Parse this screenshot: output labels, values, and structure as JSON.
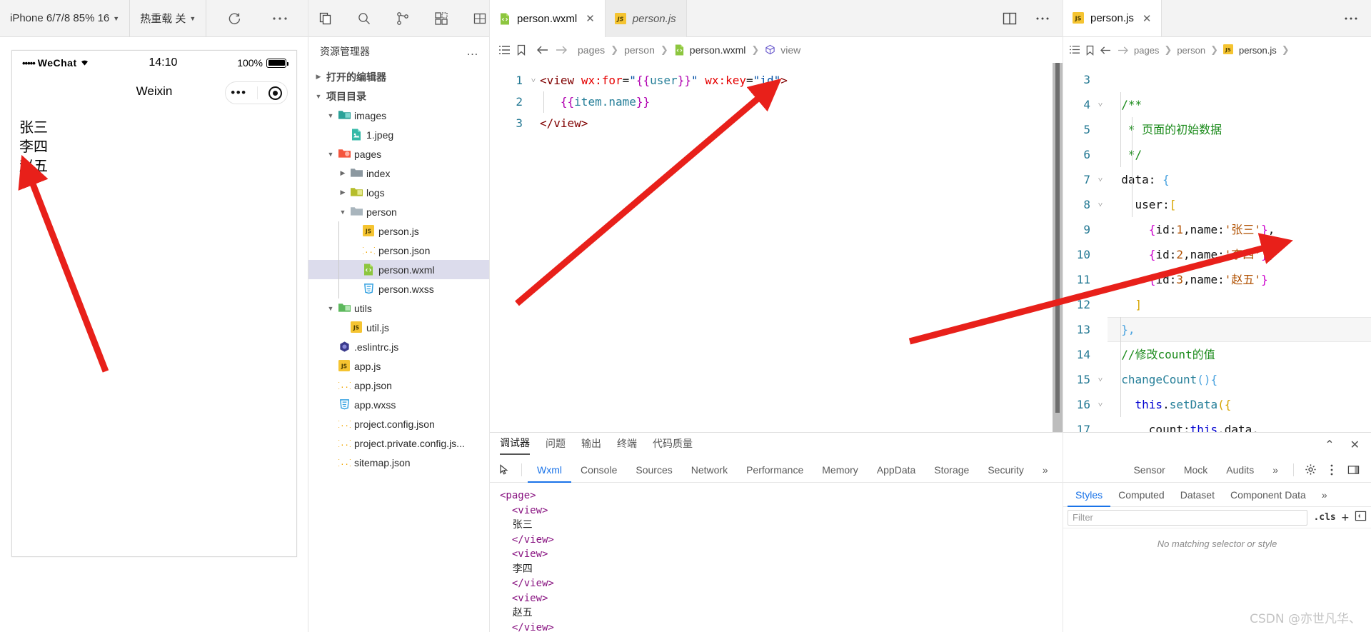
{
  "simulator": {
    "device_label": "iPhone 6/7/8 85% 16",
    "hot_reload_label": "热重载 关",
    "refresh_icon": "refresh-icon",
    "more_icon": "more-icon",
    "status_bar": {
      "carrier": "WeChat",
      "dots": "•••••",
      "time": "14:10",
      "battery_pct": "100%"
    },
    "nav_title": "Weixin",
    "capsule_dots": "•••",
    "preview_items": [
      "张三",
      "李四",
      "赵五"
    ]
  },
  "activity_bar": {
    "icons": [
      "copy-files-icon",
      "search-icon",
      "source-control-icon",
      "extensions-icon",
      "layout-icon",
      "docker-icon"
    ]
  },
  "explorer": {
    "title": "资源管理器",
    "more_label": "…",
    "sections": [
      {
        "label": "打开的编辑器",
        "expanded": false
      },
      {
        "label": "项目目录",
        "expanded": true
      }
    ],
    "tree": [
      {
        "label": "images",
        "kind": "folder-images",
        "depth": 1,
        "expanded": true,
        "selected": false
      },
      {
        "label": "1.jpeg",
        "kind": "image",
        "depth": 2,
        "expanded": null,
        "selected": false
      },
      {
        "label": "pages",
        "kind": "folder-pages",
        "depth": 1,
        "expanded": true,
        "selected": false
      },
      {
        "label": "index",
        "kind": "folder",
        "depth": 2,
        "expanded": false,
        "selected": false
      },
      {
        "label": "logs",
        "kind": "folder-logs",
        "depth": 2,
        "expanded": false,
        "selected": false
      },
      {
        "label": "person",
        "kind": "folder-open",
        "depth": 2,
        "expanded": true,
        "selected": false
      },
      {
        "label": "person.js",
        "kind": "js",
        "depth": 3,
        "expanded": null,
        "selected": false
      },
      {
        "label": "person.json",
        "kind": "json",
        "depth": 3,
        "expanded": null,
        "selected": false
      },
      {
        "label": "person.wxml",
        "kind": "wxml",
        "depth": 3,
        "expanded": null,
        "selected": true
      },
      {
        "label": "person.wxss",
        "kind": "wxss",
        "depth": 3,
        "expanded": null,
        "selected": false
      },
      {
        "label": "utils",
        "kind": "folder-utils",
        "depth": 1,
        "expanded": true,
        "selected": false
      },
      {
        "label": "util.js",
        "kind": "js",
        "depth": 2,
        "expanded": null,
        "selected": false
      },
      {
        "label": ".eslintrc.js",
        "kind": "eslint",
        "depth": 1,
        "expanded": null,
        "selected": false
      },
      {
        "label": "app.js",
        "kind": "js",
        "depth": 1,
        "expanded": null,
        "selected": false
      },
      {
        "label": "app.json",
        "kind": "json",
        "depth": 1,
        "expanded": null,
        "selected": false
      },
      {
        "label": "app.wxss",
        "kind": "wxss",
        "depth": 1,
        "expanded": null,
        "selected": false
      },
      {
        "label": "project.config.json",
        "kind": "json",
        "depth": 1,
        "expanded": null,
        "selected": false
      },
      {
        "label": "project.private.config.js...",
        "kind": "json",
        "depth": 1,
        "expanded": null,
        "selected": false
      },
      {
        "label": "sitemap.json",
        "kind": "json",
        "depth": 1,
        "expanded": null,
        "selected": false
      }
    ]
  },
  "center_editor": {
    "tabs": [
      {
        "label": "person.wxml",
        "kind": "wxml",
        "active": true,
        "closable": true
      },
      {
        "label": "person.js",
        "kind": "js",
        "active": false,
        "closable": false
      }
    ],
    "actions": [
      "split-editor-icon",
      "more-actions-icon"
    ],
    "breadcrumb": [
      "pages",
      "person",
      "person.wxml",
      "view"
    ],
    "toolbar_icons": [
      "outline-icon",
      "bookmark-icon",
      "back-icon",
      "forward-icon"
    ],
    "lines": [
      {
        "n": 1,
        "fold": "˅",
        "tokens": [
          {
            "t": "<",
            "c": "t-brk"
          },
          {
            "t": "view",
            "c": "t-tag"
          },
          {
            "t": " ",
            "c": "t-plain"
          },
          {
            "t": "wx:for",
            "c": "t-attr"
          },
          {
            "t": "=",
            "c": "t-eq"
          },
          {
            "t": "\"",
            "c": "t-str"
          },
          {
            "t": "{{",
            "c": "t-brace"
          },
          {
            "t": "user",
            "c": "t-ident"
          },
          {
            "t": "}}",
            "c": "t-brace"
          },
          {
            "t": "\"",
            "c": "t-str"
          },
          {
            "t": " ",
            "c": "t-plain"
          },
          {
            "t": "wx:key",
            "c": "t-attr"
          },
          {
            "t": "=",
            "c": "t-eq"
          },
          {
            "t": "\"id\"",
            "c": "t-str"
          },
          {
            "t": ">",
            "c": "t-brk"
          }
        ]
      },
      {
        "n": 2,
        "fold": "",
        "tokens": [
          {
            "t": "   ",
            "c": "t-plain"
          },
          {
            "t": "{{",
            "c": "t-brace"
          },
          {
            "t": "item.name",
            "c": "t-ident"
          },
          {
            "t": "}}",
            "c": "t-brace"
          }
        ]
      },
      {
        "n": 3,
        "fold": "",
        "tokens": [
          {
            "t": "</",
            "c": "t-brk"
          },
          {
            "t": "view",
            "c": "t-tag"
          },
          {
            "t": ">",
            "c": "t-brk"
          }
        ]
      }
    ]
  },
  "right_editor": {
    "tabs": [
      {
        "label": "person.js",
        "kind": "js",
        "active": true,
        "closable": true
      }
    ],
    "actions": [
      "more-actions-icon"
    ],
    "breadcrumb": [
      "pages",
      "person",
      "person.js"
    ],
    "toolbar_icons": [
      "outline-icon",
      "bookmark-icon",
      "back-icon",
      "forward-icon"
    ],
    "lines": [
      {
        "n": 3,
        "fold": "",
        "tokens": []
      },
      {
        "n": 4,
        "fold": "˅",
        "tokens": [
          {
            "t": "  ",
            "c": "t-plain"
          },
          {
            "t": "/**",
            "c": "t-cmt"
          }
        ]
      },
      {
        "n": 5,
        "fold": "",
        "tokens": [
          {
            "t": "   ",
            "c": "t-plain"
          },
          {
            "t": "* 页面的初始数据",
            "c": "t-cmt"
          }
        ]
      },
      {
        "n": 6,
        "fold": "",
        "tokens": [
          {
            "t": "   ",
            "c": "t-plain"
          },
          {
            "t": "*/",
            "c": "t-cmt"
          }
        ]
      },
      {
        "n": 7,
        "fold": "˅",
        "tokens": [
          {
            "t": "  ",
            "c": "t-plain"
          },
          {
            "t": "data",
            "c": "t-plain"
          },
          {
            "t": ": ",
            "c": "t-plain"
          },
          {
            "t": "{",
            "c": "t-brk-b"
          }
        ]
      },
      {
        "n": 8,
        "fold": "˅",
        "tokens": [
          {
            "t": "    ",
            "c": "t-plain"
          },
          {
            "t": "user",
            "c": "t-plain"
          },
          {
            "t": ":",
            "c": "t-plain"
          },
          {
            "t": "[",
            "c": "t-brk-y"
          }
        ]
      },
      {
        "n": 9,
        "fold": "",
        "tokens": [
          {
            "t": "      ",
            "c": "t-plain"
          },
          {
            "t": "{",
            "c": "t-brk-p"
          },
          {
            "t": "id",
            "c": "t-plain"
          },
          {
            "t": ":",
            "c": "t-plain"
          },
          {
            "t": "1",
            "c": "t-num"
          },
          {
            "t": ",",
            "c": "t-plain"
          },
          {
            "t": "name",
            "c": "t-plain"
          },
          {
            "t": ":",
            "c": "t-plain"
          },
          {
            "t": "'张三'",
            "c": "t-num"
          },
          {
            "t": "}",
            "c": "t-brk-p"
          },
          {
            "t": ",",
            "c": "t-plain"
          }
        ]
      },
      {
        "n": 10,
        "fold": "",
        "tokens": [
          {
            "t": "      ",
            "c": "t-plain"
          },
          {
            "t": "{",
            "c": "t-brk-p"
          },
          {
            "t": "id",
            "c": "t-plain"
          },
          {
            "t": ":",
            "c": "t-plain"
          },
          {
            "t": "2",
            "c": "t-num"
          },
          {
            "t": ",",
            "c": "t-plain"
          },
          {
            "t": "name",
            "c": "t-plain"
          },
          {
            "t": ":",
            "c": "t-plain"
          },
          {
            "t": "'李四'",
            "c": "t-num"
          },
          {
            "t": "}",
            "c": "t-brk-p"
          },
          {
            "t": ",",
            "c": "t-plain"
          }
        ]
      },
      {
        "n": 11,
        "fold": "",
        "tokens": [
          {
            "t": "      ",
            "c": "t-plain"
          },
          {
            "t": "{",
            "c": "t-brk-p"
          },
          {
            "t": "id",
            "c": "t-plain"
          },
          {
            "t": ":",
            "c": "t-plain"
          },
          {
            "t": "3",
            "c": "t-num"
          },
          {
            "t": ",",
            "c": "t-plain"
          },
          {
            "t": "name",
            "c": "t-plain"
          },
          {
            "t": ":",
            "c": "t-plain"
          },
          {
            "t": "'赵五'",
            "c": "t-num"
          },
          {
            "t": "}",
            "c": "t-brk-p"
          }
        ]
      },
      {
        "n": 12,
        "fold": "",
        "tokens": [
          {
            "t": "    ",
            "c": "t-plain"
          },
          {
            "t": "]",
            "c": "t-brk-y"
          }
        ]
      },
      {
        "n": 13,
        "fold": "",
        "tokens": [
          {
            "t": "  ",
            "c": "t-plain"
          },
          {
            "t": "}",
            "c": "t-brk-b"
          },
          {
            "t": ",",
            "c": "t-brk-b"
          }
        ]
      },
      {
        "n": 14,
        "fold": "",
        "tokens": [
          {
            "t": "  ",
            "c": "t-plain"
          },
          {
            "t": "//修改count的值",
            "c": "t-cmt"
          }
        ]
      },
      {
        "n": 15,
        "fold": "˅",
        "tokens": [
          {
            "t": "  ",
            "c": "t-plain"
          },
          {
            "t": "changeCount",
            "c": "t-ident"
          },
          {
            "t": "()",
            "c": "t-brk-b"
          },
          {
            "t": "{",
            "c": "t-brk-b"
          }
        ]
      },
      {
        "n": 16,
        "fold": "˅",
        "tokens": [
          {
            "t": "    ",
            "c": "t-plain"
          },
          {
            "t": "this",
            "c": "t-key"
          },
          {
            "t": ".",
            "c": "t-plain"
          },
          {
            "t": "setData",
            "c": "t-ident"
          },
          {
            "t": "(",
            "c": "t-brk-y"
          },
          {
            "t": "{",
            "c": "t-brk-y"
          }
        ]
      },
      {
        "n": 17,
        "fold": "",
        "tokens": [
          {
            "t": "      ",
            "c": "t-plain"
          },
          {
            "t": "count",
            "c": "t-plain"
          },
          {
            "t": ":",
            "c": "t-plain"
          },
          {
            "t": "this",
            "c": "t-key"
          },
          {
            "t": ".",
            "c": "t-plain"
          },
          {
            "t": "data",
            "c": "t-plain"
          },
          {
            "t": ".",
            "c": "t-plain"
          }
        ]
      }
    ]
  },
  "bottom_panel": {
    "panel_tabs": [
      {
        "label": "调试器",
        "active": true
      },
      {
        "label": "问题",
        "active": false
      },
      {
        "label": "输出",
        "active": false
      },
      {
        "label": "终端",
        "active": false
      },
      {
        "label": "代码质量",
        "active": false
      }
    ],
    "devtools_tabs": [
      {
        "label": "Wxml",
        "active": true
      },
      {
        "label": "Console",
        "active": false
      },
      {
        "label": "Sources",
        "active": false
      },
      {
        "label": "Network",
        "active": false
      },
      {
        "label": "Performance",
        "active": false
      },
      {
        "label": "Memory",
        "active": false
      },
      {
        "label": "AppData",
        "active": false
      },
      {
        "label": "Storage",
        "active": false
      },
      {
        "label": "Security",
        "active": false
      },
      {
        "label": "Sensor",
        "active": false
      },
      {
        "label": "Mock",
        "active": false
      },
      {
        "label": "Audits",
        "active": false
      }
    ],
    "overflow_label": "»",
    "inspect_icon": "inspect-element-icon",
    "settings_icon": "gear-icon",
    "kebab_icon": "more-vertical-icon",
    "dock_icon": "dock-side-icon",
    "collapse_icon": "chevron-up-icon",
    "close_icon": "close-icon",
    "wxml_tree": [
      {
        "indent": 0,
        "type": "tag",
        "text": "<page>"
      },
      {
        "indent": 1,
        "type": "tag",
        "text": "<view>"
      },
      {
        "indent": 2,
        "type": "text",
        "text": "张三"
      },
      {
        "indent": 1,
        "type": "tag",
        "text": "</view>"
      },
      {
        "indent": 1,
        "type": "tag",
        "text": "<view>"
      },
      {
        "indent": 2,
        "type": "text",
        "text": "李四"
      },
      {
        "indent": 1,
        "type": "tag",
        "text": "</view>"
      },
      {
        "indent": 1,
        "type": "tag",
        "text": "<view>"
      },
      {
        "indent": 2,
        "type": "text",
        "text": "赵五"
      },
      {
        "indent": 1,
        "type": "tag",
        "text": "</view>"
      }
    ],
    "styles": {
      "tabs": [
        {
          "label": "Styles",
          "active": true
        },
        {
          "label": "Computed",
          "active": false
        },
        {
          "label": "Dataset",
          "active": false
        },
        {
          "label": "Component Data",
          "active": false
        }
      ],
      "overflow_label": "»",
      "filter_placeholder": "Filter",
      "cls_label": ".cls",
      "add_label": "+",
      "empty_message": "No matching selector or style"
    }
  },
  "watermark": "CSDN @亦世凡华、",
  "colors": {
    "accent": "#1a73e8",
    "selection": "#dcdcec",
    "toolbar_bg": "#f3f3f3",
    "arrow_red": "#e8201a",
    "line_number": "#237893"
  }
}
